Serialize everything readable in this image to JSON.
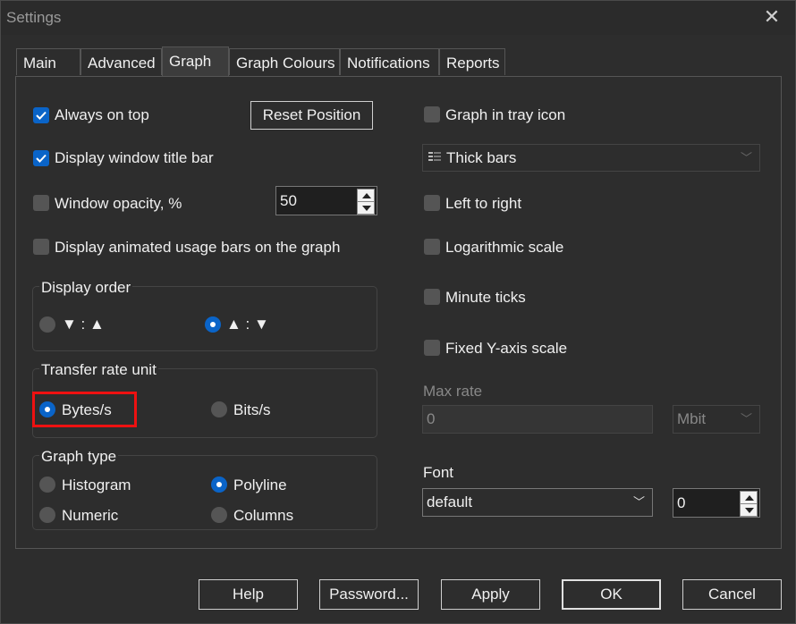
{
  "window": {
    "title": "Settings"
  },
  "tabs": [
    {
      "label": "Main"
    },
    {
      "label": "Advanced"
    },
    {
      "label": "Graph"
    },
    {
      "label": "Graph Colours"
    },
    {
      "label": "Notifications"
    },
    {
      "label": "Reports"
    }
  ],
  "left": {
    "always_on_top": {
      "label": "Always on top",
      "checked": true
    },
    "reset_position": "Reset Position",
    "display_title_bar": {
      "label": "Display window title bar",
      "checked": true
    },
    "window_opacity": {
      "label": "Window opacity, %",
      "checked": false,
      "value": "50"
    },
    "animated_bars": {
      "label": "Display animated usage bars on the graph",
      "checked": false
    },
    "display_order": {
      "title": "Display order",
      "options": [
        {
          "label": "▼ : ▲",
          "selected": false
        },
        {
          "label": "▲ : ▼",
          "selected": true
        }
      ]
    },
    "transfer_rate": {
      "title": "Transfer rate unit",
      "options": [
        {
          "label": "Bytes/s",
          "selected": true
        },
        {
          "label": "Bits/s",
          "selected": false
        }
      ]
    },
    "graph_type": {
      "title": "Graph type",
      "options": [
        {
          "label": "Histogram",
          "selected": false
        },
        {
          "label": "Polyline",
          "selected": true
        },
        {
          "label": "Numeric",
          "selected": false
        },
        {
          "label": "Columns",
          "selected": false
        }
      ]
    }
  },
  "right": {
    "graph_tray": {
      "label": "Graph in tray icon",
      "checked": false
    },
    "bar_style": {
      "value": "Thick bars"
    },
    "left_to_right": {
      "label": "Left to right",
      "checked": false
    },
    "log_scale": {
      "label": "Logarithmic scale",
      "checked": false
    },
    "minute_ticks": {
      "label": "Minute ticks",
      "checked": false
    },
    "fixed_y": {
      "label": "Fixed Y-axis scale",
      "checked": false
    },
    "max_rate": {
      "label": "Max rate",
      "value": "0",
      "unit": "Mbit"
    },
    "font": {
      "label": "Font",
      "value": "default",
      "size": "0"
    }
  },
  "buttons": {
    "help": "Help",
    "password": "Password...",
    "apply": "Apply",
    "ok": "OK",
    "cancel": "Cancel"
  },
  "colors": {
    "accent": "#0a64c8",
    "highlight": "#ee1111"
  }
}
